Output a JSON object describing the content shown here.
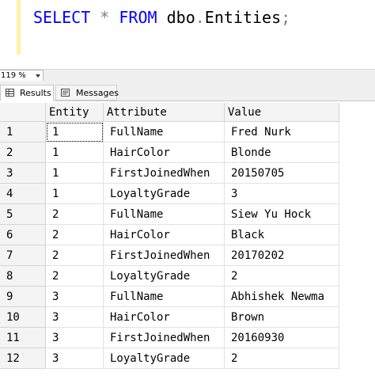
{
  "editor": {
    "tokens": {
      "select": "SELECT",
      "star": "*",
      "from": "FROM",
      "schema": "dbo",
      "dot": ".",
      "table": "Entities",
      "semi": ";"
    },
    "colors": {
      "keyword": "#0000ff",
      "operator": "#808080",
      "identifier": "#000000"
    }
  },
  "zoom": {
    "value": "119 %"
  },
  "tabs": {
    "results": "Results",
    "messages": "Messages"
  },
  "grid": {
    "columns": [
      "Entity",
      "Attribute",
      "Value"
    ],
    "rows": [
      {
        "num": "1",
        "entity": "1",
        "attribute": "FullName",
        "value": "Fred Nurk"
      },
      {
        "num": "2",
        "entity": "1",
        "attribute": "HairColor",
        "value": "Blonde"
      },
      {
        "num": "3",
        "entity": "1",
        "attribute": "FirstJoinedWhen",
        "value": "20150705"
      },
      {
        "num": "4",
        "entity": "1",
        "attribute": "LoyaltyGrade",
        "value": "3"
      },
      {
        "num": "5",
        "entity": "2",
        "attribute": "FullName",
        "value": "Siew Yu Hock"
      },
      {
        "num": "6",
        "entity": "2",
        "attribute": "HairColor",
        "value": "Black"
      },
      {
        "num": "7",
        "entity": "2",
        "attribute": "FirstJoinedWhen",
        "value": "20170202"
      },
      {
        "num": "8",
        "entity": "2",
        "attribute": "LoyaltyGrade",
        "value": "2"
      },
      {
        "num": "9",
        "entity": "3",
        "attribute": "FullName",
        "value": "Abhishek Newma"
      },
      {
        "num": "10",
        "entity": "3",
        "attribute": "HairColor",
        "value": "Brown"
      },
      {
        "num": "11",
        "entity": "3",
        "attribute": "FirstJoinedWhen",
        "value": "20160930"
      },
      {
        "num": "12",
        "entity": "3",
        "attribute": "LoyaltyGrade",
        "value": "2"
      }
    ]
  }
}
